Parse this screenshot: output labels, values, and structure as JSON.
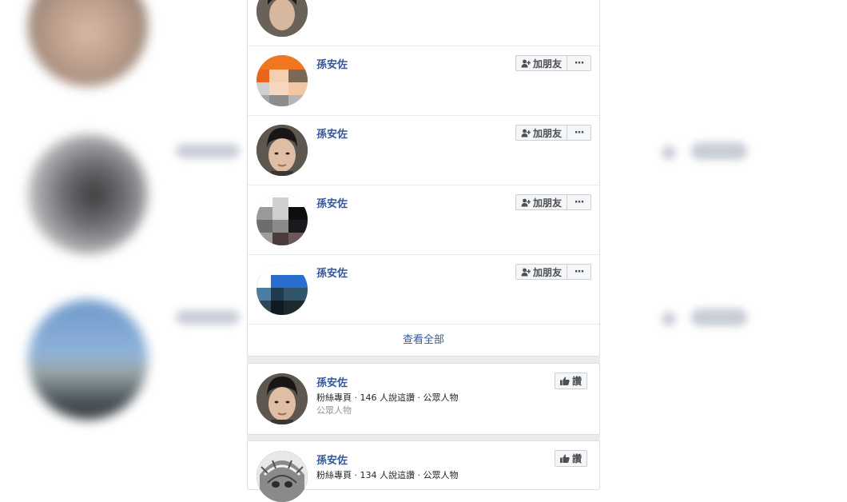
{
  "friends_section": {
    "rows": [
      {
        "name": "孫安佐",
        "add_label": "加朋友",
        "more_label": "···"
      },
      {
        "name": "孫安佐",
        "add_label": "加朋友",
        "more_label": "···"
      },
      {
        "name": "孫安佐",
        "add_label": "加朋友",
        "more_label": "···"
      },
      {
        "name": "孫安佐",
        "add_label": "加朋友",
        "more_label": "···"
      }
    ],
    "see_all_label": "查看全部"
  },
  "pages_section": {
    "items": [
      {
        "name": "孫安佐",
        "meta": "粉絲專頁 · 146 人說這讚 · 公眾人物",
        "category": "公眾人物",
        "like_label": "讚"
      },
      {
        "name": "孫安佐",
        "meta": "粉絲專頁 · 134 人說這讚 · 公眾人物",
        "like_label": "讚"
      }
    ]
  },
  "icons": {
    "add_friend": "add-friend-icon",
    "like": "thumbs-up-icon",
    "more": "more-options-icon"
  },
  "colors": {
    "link_blue": "#365899",
    "background_gray": "#e9ebee",
    "button_bg": "#f5f6f7"
  }
}
